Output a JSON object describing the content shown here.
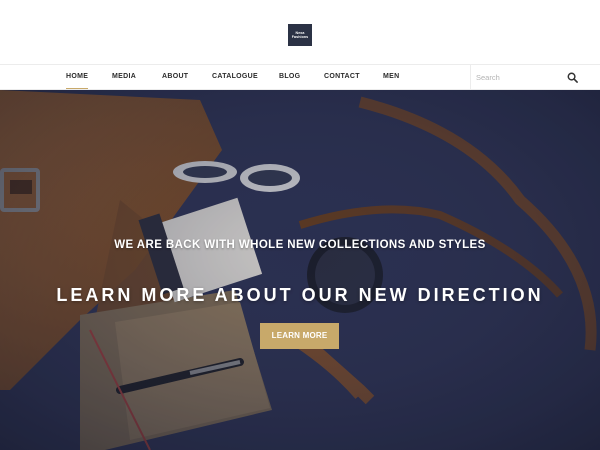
{
  "logo": {
    "line1": "Nexa",
    "line2": "Fashions"
  },
  "nav": {
    "items": [
      {
        "label": "HOME",
        "active": true
      },
      {
        "label": "MEDIA"
      },
      {
        "label": "ABOUT"
      },
      {
        "label": "CATALOGUE"
      },
      {
        "label": "BLOG"
      },
      {
        "label": "CONTACT"
      },
      {
        "label": "MEN"
      }
    ],
    "search": {
      "placeholder": "Search",
      "icon": "search-icon"
    }
  },
  "hero": {
    "subtitle": "WE ARE BACK WITH WHOLE NEW COLLECTIONS AND STYLES",
    "title": "LEARN MORE ABOUT OUR NEW DIRECTION",
    "button_label": "LEARN MORE",
    "background_color": "#2e3356"
  },
  "colors": {
    "accent": "#c8a96a",
    "logo_bg": "#2b3245",
    "nav_text": "#2b2b2b"
  }
}
